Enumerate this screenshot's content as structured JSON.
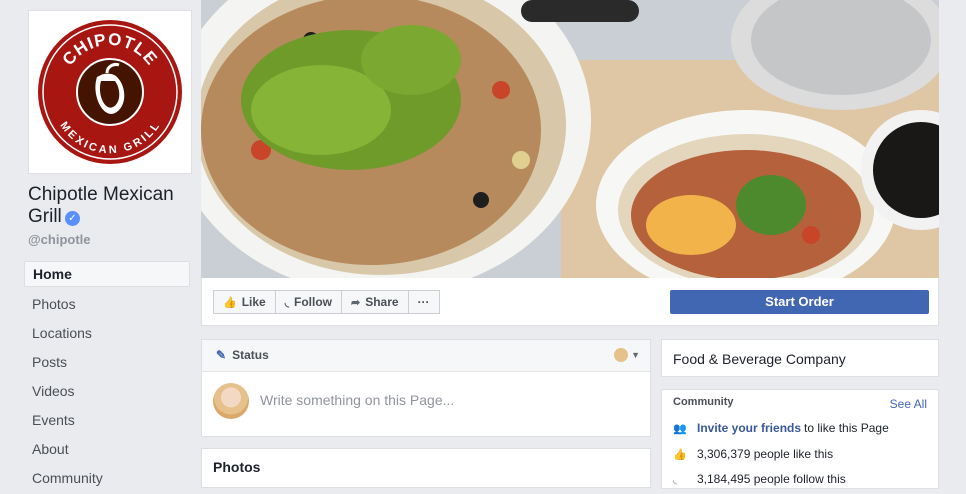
{
  "sidebar": {
    "logo_text_top": "CHIPOTLE",
    "logo_text_bottom": "MEXICAN GRILL",
    "page_name": "Chipotle Mexican Grill",
    "handle": "@chipotle",
    "nav": [
      {
        "label": "Home",
        "active": true
      },
      {
        "label": "Photos"
      },
      {
        "label": "Locations"
      },
      {
        "label": "Posts"
      },
      {
        "label": "Videos"
      },
      {
        "label": "Events"
      },
      {
        "label": "About"
      },
      {
        "label": "Community"
      }
    ]
  },
  "actions": {
    "like": "Like",
    "follow": "Follow",
    "share": "Share",
    "more": "···",
    "start_order": "Start Order"
  },
  "status": {
    "tab_label": "Status",
    "placeholder": "Write something on this Page..."
  },
  "photos": {
    "title": "Photos"
  },
  "about": {
    "category": "Food & Beverage Company"
  },
  "community": {
    "title": "Community",
    "see_all": "See All",
    "invite_link": "Invite your friends",
    "invite_rest": "to like this Page",
    "likes": "3,306,379 people like this",
    "follows": "3,184,495 people follow this"
  },
  "colors": {
    "brand_red": "#a81612",
    "facebook_blue": "#4267b2"
  }
}
